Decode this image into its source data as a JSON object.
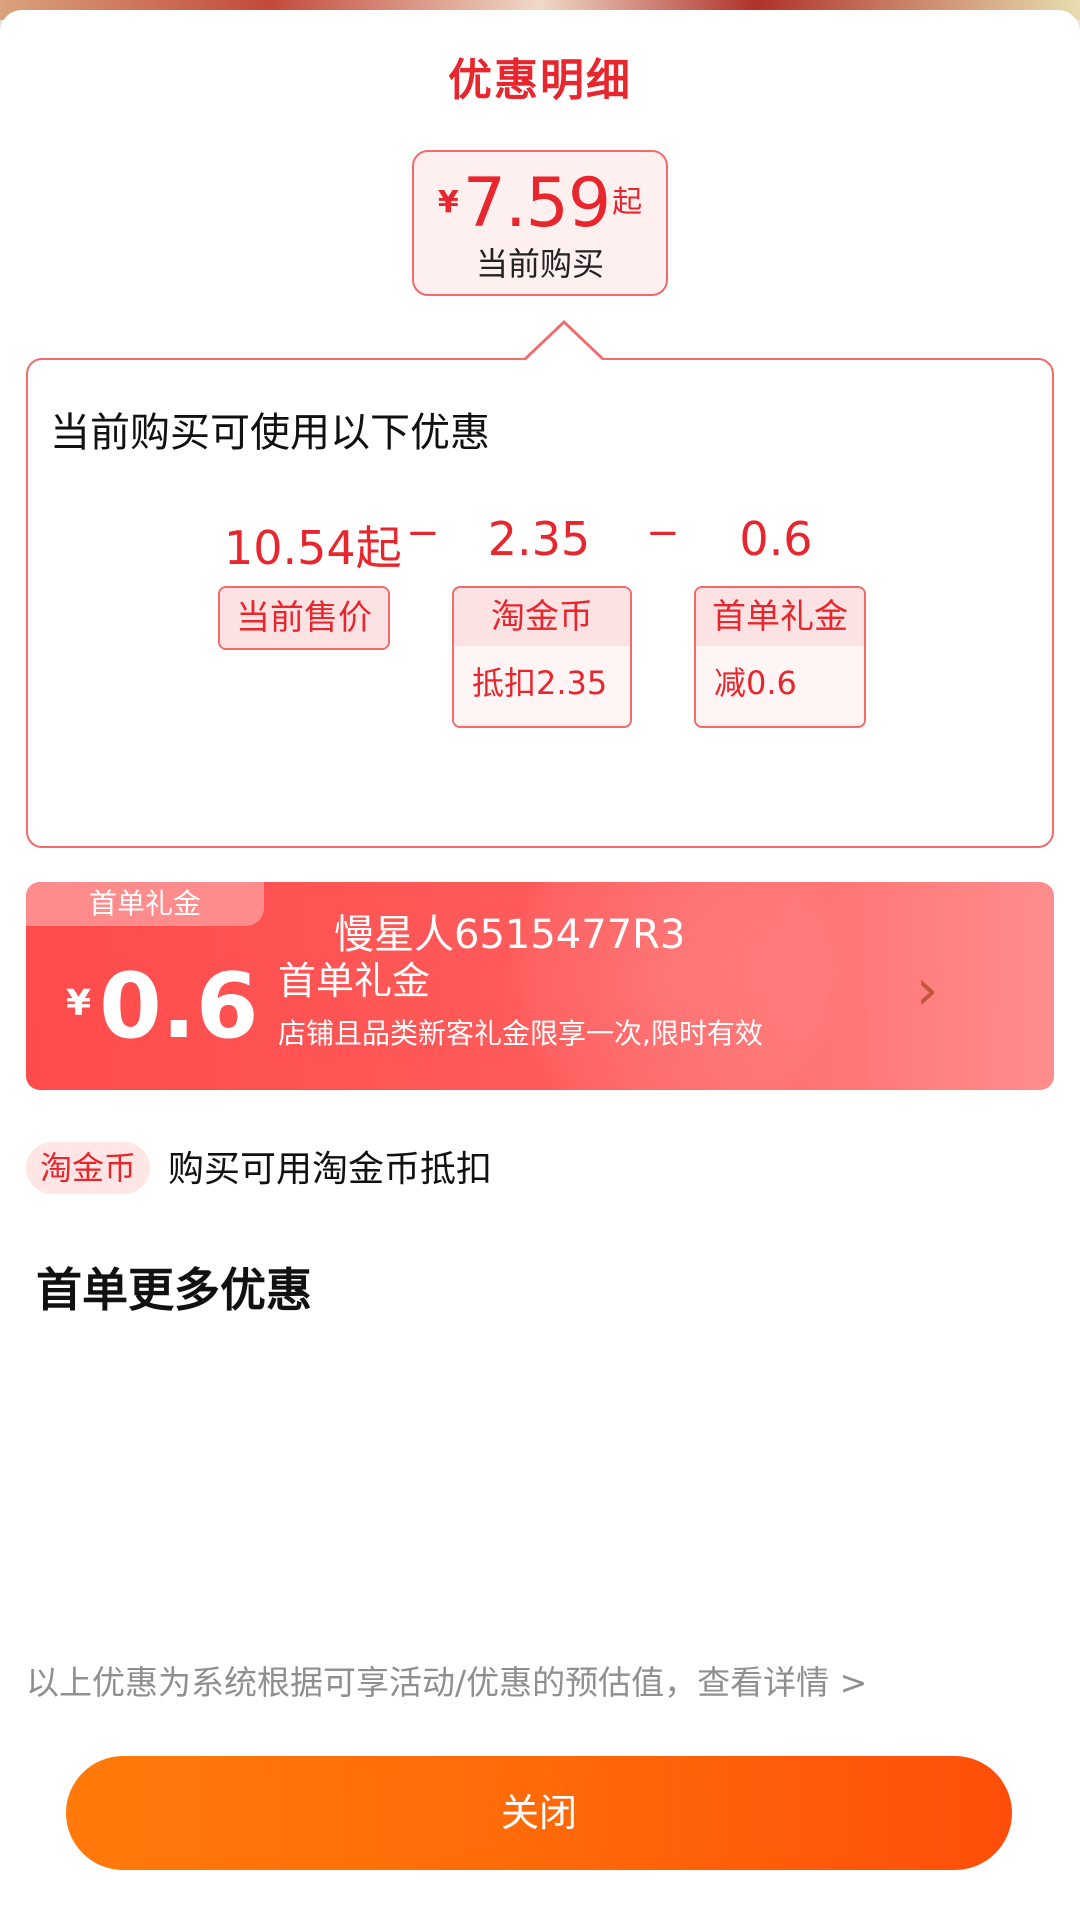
{
  "sheet": {
    "title": "优惠明细"
  },
  "final_price": {
    "currency": "¥",
    "amount": "7.59",
    "suffix": "起",
    "label": "当前购买"
  },
  "breakdown": {
    "heading": "当前购买可使用以下优惠",
    "operator": "−",
    "base": {
      "value": "10.54起",
      "tag": "当前售价"
    },
    "items": [
      {
        "value": "2.35",
        "tag_title": "淘金币",
        "tag_detail": "抵扣2.35"
      },
      {
        "value": "0.6",
        "tag_title": "首单礼金",
        "tag_detail": "减0.6"
      }
    ]
  },
  "coupon": {
    "tab": "首单礼金",
    "currency": "¥",
    "amount": "0.6",
    "user": "慢星人6515477R3",
    "name": "首单礼金",
    "description": "店铺且品类新客礼金限享一次,限时有效",
    "arrow_icon": "chevron-right-icon"
  },
  "coin": {
    "badge": "淘金币",
    "text": "购买可用淘金币抵扣"
  },
  "more_section": {
    "title": "首单更多优惠"
  },
  "disclaimer": "以上优惠为系统根据可享活动/优惠的预估值，查看详情 >",
  "close_button": {
    "label": "关闭"
  },
  "colors": {
    "accent": "#e8262d",
    "coupon": "#ff4b4b",
    "button": "#ff6a08"
  }
}
